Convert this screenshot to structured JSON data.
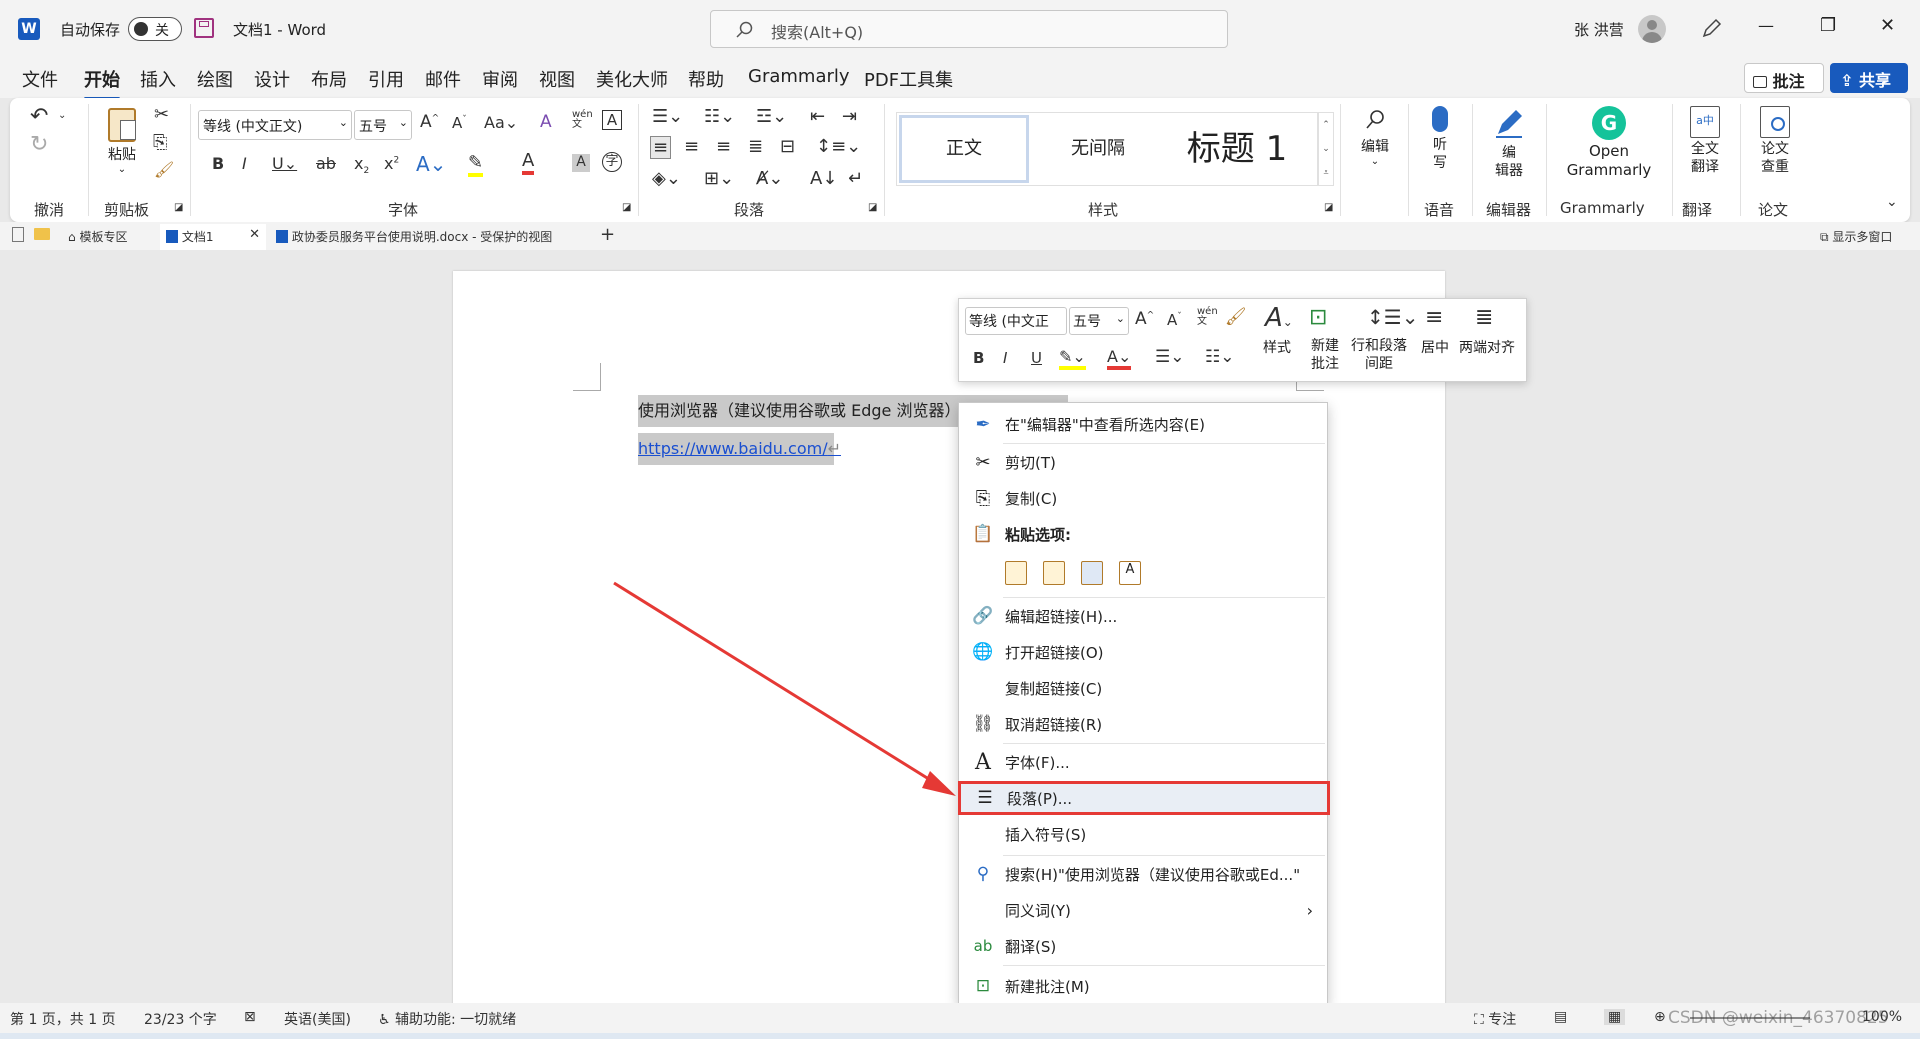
{
  "title_bar": {
    "autosave_label": "自动保存",
    "autosave_state": "关",
    "doc_title": "文档1  -  Word",
    "search_placeholder": "搜索(Alt+Q)",
    "user_name": "张 洪营",
    "minimize": "—",
    "restore": "❐",
    "close": "✕"
  },
  "menu": {
    "items": [
      "文件",
      "开始",
      "插入",
      "绘图",
      "设计",
      "布局",
      "引用",
      "邮件",
      "审阅",
      "视图",
      "美化大师",
      "帮助",
      "Grammarly",
      "PDF工具集"
    ],
    "comment_btn": "批注",
    "share_btn": "共享"
  },
  "ribbon": {
    "groups": {
      "undo": "撤消",
      "clipboard": "剪贴板",
      "font": "字体",
      "paragraph": "段落",
      "styles": "样式",
      "voice": "语音",
      "editor": "编辑器",
      "grammarly": "Grammarly",
      "translate": "翻译",
      "paper": "论文"
    },
    "paste_label": "粘贴",
    "font_name": "等线 (中文正文)",
    "font_size": "五号",
    "styles": {
      "normal": "正文",
      "no_spacing": "无间隔",
      "heading1": "标题 1"
    },
    "editing": "编辑",
    "dictate": "听\n写",
    "editor_btn": "编\n辑器",
    "grammarly_btn": "Open\nGrammarly",
    "translate_btn": "全文\n翻译",
    "paper_btn": "论文\n查重"
  },
  "doc_tabs": {
    "templates": "模板专区",
    "doc1": "文档1",
    "doc2": "政协委员服务平台使用说明.docx  -  受保护的视图",
    "add": "+",
    "multi_window": "显示多窗口"
  },
  "document": {
    "line1": "使用浏览器（建议使用谷歌或 Edge 浏览器）打开链接：",
    "line2": "https://www.baidu.com/"
  },
  "mini_toolbar": {
    "font_name": "等线 (中文正",
    "font_size": "五号",
    "styles": "样式",
    "new_comment": "新建\n批注",
    "line_spacing": "行和段落\n间距",
    "center": "居中",
    "justify": "两端对齐"
  },
  "context_menu": {
    "items": [
      {
        "label": "在\"编辑器\"中查看所选内容(E)",
        "icon": "editor-icon"
      },
      {
        "label": "剪切(T)",
        "icon": "scissors-icon"
      },
      {
        "label": "复制(C)",
        "icon": "copy-icon"
      },
      {
        "label": "粘贴选项:",
        "icon": "paste-icon"
      },
      {
        "label": "编辑超链接(H)...",
        "icon": "link-icon"
      },
      {
        "label": "打开超链接(O)",
        "icon": "globe-link-icon"
      },
      {
        "label": "复制超链接(C)",
        "icon": ""
      },
      {
        "label": "取消超链接(R)",
        "icon": "unlink-icon"
      },
      {
        "label": "字体(F)...",
        "icon": "font-icon"
      },
      {
        "label": "段落(P)...",
        "icon": "paragraph-icon"
      },
      {
        "label": "插入符号(S)",
        "icon": ""
      },
      {
        "label": "搜索(H)\"使用浏览器（建议使用谷歌或Ed...\"",
        "icon": "search-icon"
      },
      {
        "label": "同义词(Y)",
        "icon": ""
      },
      {
        "label": "翻译(S)",
        "icon": "translate-icon"
      },
      {
        "label": "新建批注(M)",
        "icon": "new-comment-icon"
      }
    ],
    "highlight_color": "#e53935"
  },
  "status": {
    "page": "第 1 页，共 1 页",
    "words": "23/23 个字",
    "language": "英语(美国)",
    "accessibility": "辅助功能: 一切就绪",
    "focus": "专注",
    "zoom": "100%",
    "watermark": "CSDN @weixin_46370825"
  }
}
